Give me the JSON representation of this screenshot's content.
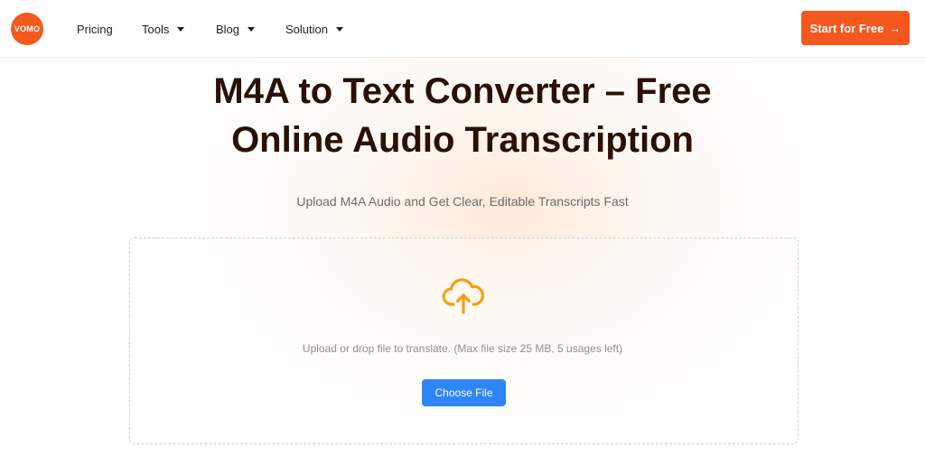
{
  "header": {
    "logo_text": "VOMO",
    "nav": [
      {
        "label": "Pricing",
        "has_dropdown": false
      },
      {
        "label": "Tools",
        "has_dropdown": true
      },
      {
        "label": "Blog",
        "has_dropdown": true
      },
      {
        "label": "Solution",
        "has_dropdown": true
      }
    ],
    "cta_label": "Start for Free",
    "cta_icon": "arrow-right-icon"
  },
  "hero": {
    "title_line1": "M4A to Text Converter – Free",
    "title_line2": "Online Audio Transcription",
    "subtitle": "Upload M4A Audio and Get Clear, Editable Transcripts Fast"
  },
  "upload": {
    "icon": "cloud-upload-icon",
    "hint": "Upload or drop file to translate. (Max file size 25 MB, 5 usages left)",
    "button_label": "Choose File"
  },
  "colors": {
    "brand": "#f4581f",
    "primary_button": "#2e85f5",
    "upload_icon": "#f5a00f",
    "title": "#2a1106"
  }
}
